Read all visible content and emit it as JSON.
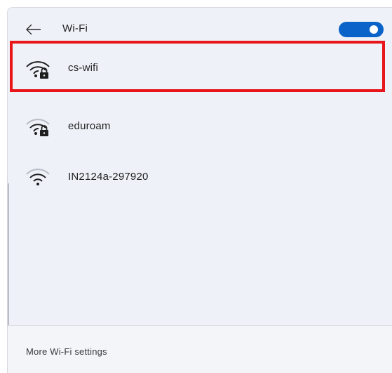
{
  "header": {
    "back_icon": "arrow-left-icon",
    "title": "Wi-Fi",
    "toggle_state": "on",
    "accent_color": "#0a63c9"
  },
  "networks": [
    {
      "name": "cs-wifi",
      "icon": "wifi-secured-icon",
      "selected": true
    },
    {
      "name": "eduroam",
      "icon": "wifi-secured-icon",
      "selected": false
    },
    {
      "name": "IN2124a-297920",
      "icon": "wifi-open-icon",
      "selected": false
    }
  ],
  "highlight_color": "#e8161a",
  "footer": {
    "more_settings_label": "More Wi-Fi settings"
  }
}
